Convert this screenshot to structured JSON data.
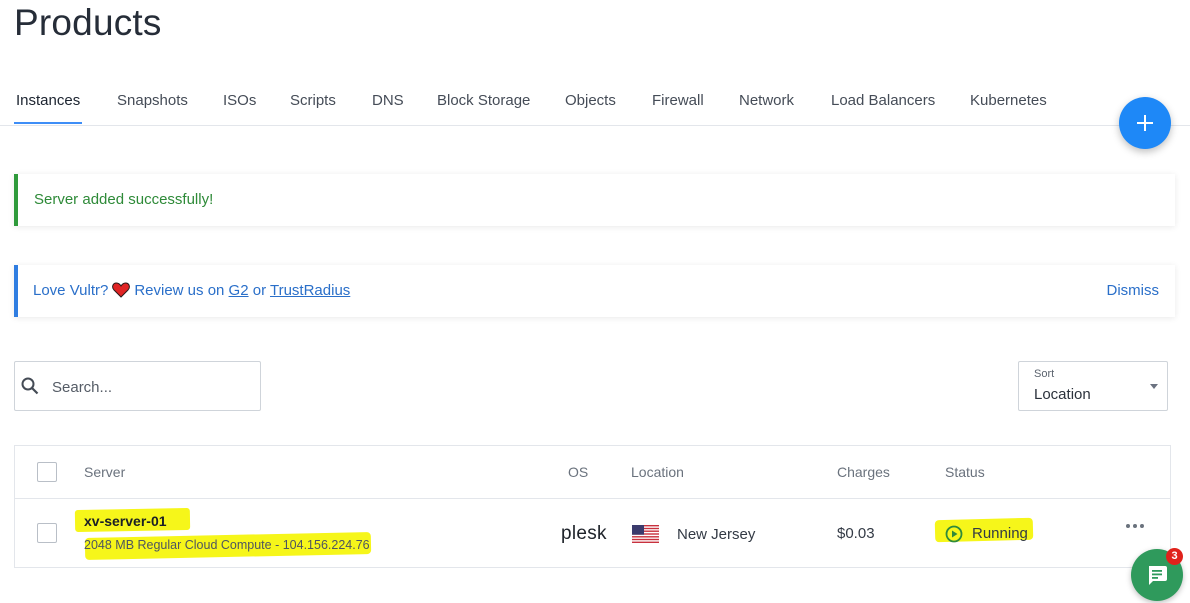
{
  "page": {
    "title": "Products"
  },
  "tabs": [
    {
      "label": "Instances",
      "active": true
    },
    {
      "label": "Snapshots"
    },
    {
      "label": "ISOs"
    },
    {
      "label": "Scripts"
    },
    {
      "label": "DNS"
    },
    {
      "label": "Block Storage"
    },
    {
      "label": "Objects"
    },
    {
      "label": "Firewall"
    },
    {
      "label": "Network"
    },
    {
      "label": "Load Balancers"
    },
    {
      "label": "Kubernetes"
    }
  ],
  "alerts": {
    "success": {
      "text": "Server added successfully!"
    },
    "review": {
      "prefix": "Love Vultr?",
      "middle": "Review us on",
      "g2_link": "G2",
      "or": "or",
      "trustradius_link": "TrustRadius",
      "dismiss": "Dismiss"
    }
  },
  "search": {
    "placeholder": "Search..."
  },
  "sort": {
    "label": "Sort",
    "value": "Location"
  },
  "table": {
    "headers": {
      "server": "Server",
      "os": "OS",
      "location": "Location",
      "charges": "Charges",
      "status": "Status"
    },
    "rows": [
      {
        "name": "xv-server-01",
        "details": "2048 MB Regular Cloud Compute - 104.156.224.76",
        "os": "plesk",
        "location": "New Jersey",
        "flag_icon": "us-flag-icon",
        "charges": "$0.03",
        "status": "Running",
        "status_icon": "play-circle-icon"
      }
    ]
  },
  "chat": {
    "badge": "3"
  },
  "colors": {
    "accent": "#1e88f7",
    "success": "#2e8a38",
    "info": "#2a6fc9",
    "chat": "#2f9a5c",
    "highlight": "#f6f61a"
  }
}
